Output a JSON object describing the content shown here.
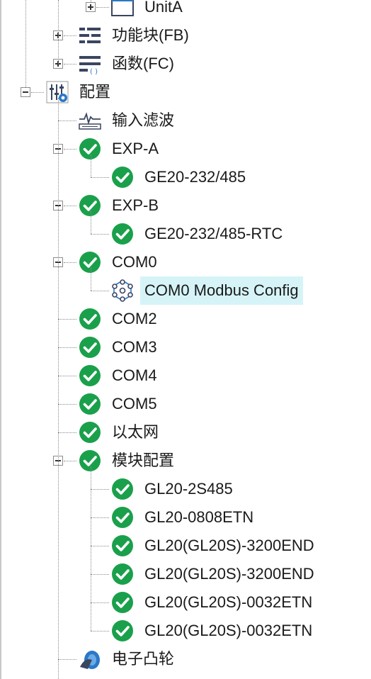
{
  "tree": [
    {
      "label": "UnitA",
      "icon": "unit-frame-icon",
      "depth": 2,
      "toggle": "plus"
    },
    {
      "label": "功能块(FB)",
      "icon": "function-block-icon",
      "depth": 1,
      "toggle": "plus"
    },
    {
      "label": "函数(FC)",
      "icon": "function-icon",
      "depth": 1,
      "toggle": "plus"
    },
    {
      "label": "配置",
      "icon": "config-settings-icon",
      "depth": 0,
      "toggle": "minus"
    },
    {
      "label": "输入滤波",
      "icon": "input-filter-icon",
      "depth": 1,
      "toggle": "none"
    },
    {
      "label": "EXP-A",
      "icon": "check-circle-icon",
      "depth": 1,
      "toggle": "minus"
    },
    {
      "label": "GE20-232/485",
      "icon": "check-circle-icon",
      "depth": 2,
      "toggle": "none"
    },
    {
      "label": "EXP-B",
      "icon": "check-circle-icon",
      "depth": 1,
      "toggle": "minus"
    },
    {
      "label": "GE20-232/485-RTC",
      "icon": "check-circle-icon",
      "depth": 2,
      "toggle": "none"
    },
    {
      "label": "COM0",
      "icon": "check-circle-icon",
      "depth": 1,
      "toggle": "minus"
    },
    {
      "label": "COM0 Modbus Config",
      "icon": "modbus-network-icon",
      "depth": 2,
      "toggle": "none",
      "selected": true
    },
    {
      "label": "COM2",
      "icon": "check-circle-icon",
      "depth": 1,
      "toggle": "none"
    },
    {
      "label": "COM3",
      "icon": "check-circle-icon",
      "depth": 1,
      "toggle": "none"
    },
    {
      "label": "COM4",
      "icon": "check-circle-icon",
      "depth": 1,
      "toggle": "none"
    },
    {
      "label": "COM5",
      "icon": "check-circle-icon",
      "depth": 1,
      "toggle": "none"
    },
    {
      "label": "以太网",
      "icon": "check-circle-icon",
      "depth": 1,
      "toggle": "none"
    },
    {
      "label": "模块配置",
      "icon": "check-circle-icon",
      "depth": 1,
      "toggle": "minus"
    },
    {
      "label": "GL20-2S485",
      "icon": "check-circle-icon",
      "depth": 2,
      "toggle": "none"
    },
    {
      "label": "GL20-0808ETN",
      "icon": "check-circle-icon",
      "depth": 2,
      "toggle": "none"
    },
    {
      "label": "GL20(GL20S)-3200END",
      "icon": "check-circle-icon",
      "depth": 2,
      "toggle": "none"
    },
    {
      "label": "GL20(GL20S)-3200END",
      "icon": "check-circle-icon",
      "depth": 2,
      "toggle": "none"
    },
    {
      "label": "GL20(GL20S)-0032ETN",
      "icon": "check-circle-icon",
      "depth": 2,
      "toggle": "none"
    },
    {
      "label": "GL20(GL20S)-0032ETN",
      "icon": "check-circle-icon",
      "depth": 2,
      "toggle": "none"
    },
    {
      "label": "电子凸轮",
      "icon": "electronic-cam-icon",
      "depth": 1,
      "toggle": "none"
    }
  ],
  "colors": {
    "status_ok": "#1aa04b",
    "selection": "#d6f4f7",
    "icon_dark": "#3a4560",
    "icon_blue": "#2a78c8"
  }
}
